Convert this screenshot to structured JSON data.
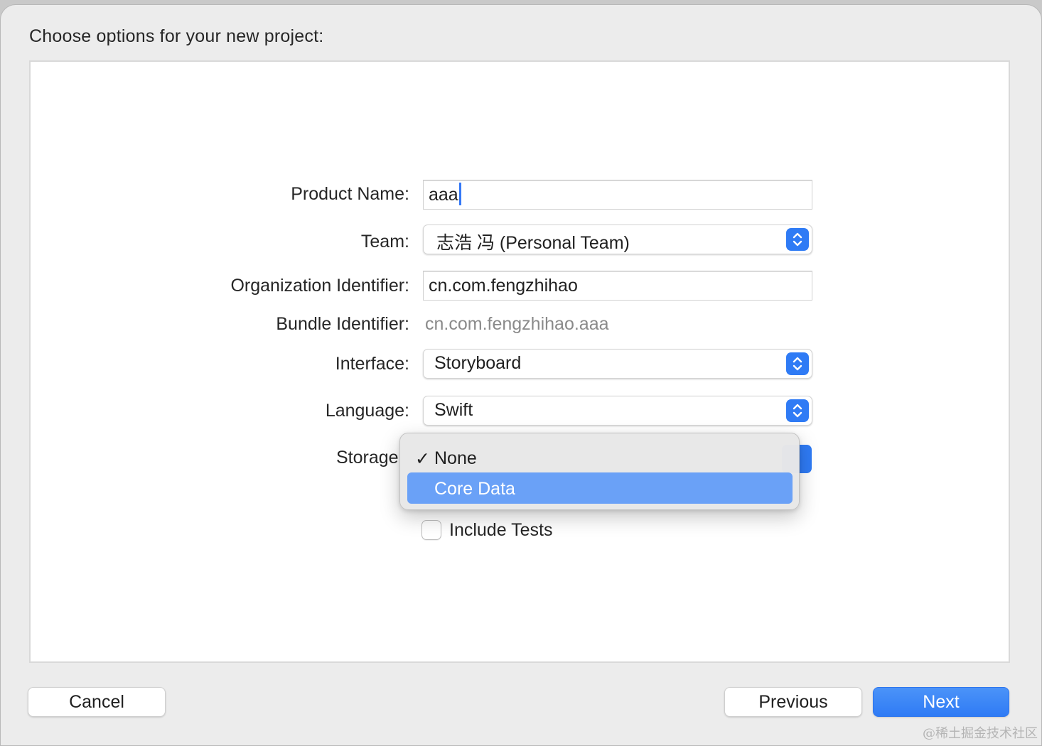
{
  "dialog": {
    "title": "Choose options for your new project:"
  },
  "form": {
    "product_name": {
      "label": "Product Name:",
      "value": "aaa"
    },
    "team": {
      "label": "Team:",
      "value": "志浩 冯 (Personal Team)"
    },
    "organization_identifier": {
      "label": "Organization Identifier:",
      "value": "cn.com.fengzhihao"
    },
    "bundle_identifier": {
      "label": "Bundle Identifier:",
      "value": "cn.com.fengzhihao.aaa"
    },
    "interface": {
      "label": "Interface:",
      "value": "Storyboard"
    },
    "language": {
      "label": "Language:",
      "value": "Swift"
    },
    "storage": {
      "label": "Storage",
      "menu": {
        "items": [
          {
            "label": "None",
            "checked": true,
            "highlighted": false
          },
          {
            "label": "Core Data",
            "checked": false,
            "highlighted": true
          }
        ]
      }
    },
    "include_tests": {
      "label": "Include Tests",
      "checked": false
    }
  },
  "buttons": {
    "cancel": "Cancel",
    "previous": "Previous",
    "next": "Next"
  },
  "watermark": "@稀土掘金技术社区",
  "colors": {
    "accent": "#2f7bf5",
    "menu_highlight": "#6aa1f7",
    "caret": "#3478f6"
  }
}
